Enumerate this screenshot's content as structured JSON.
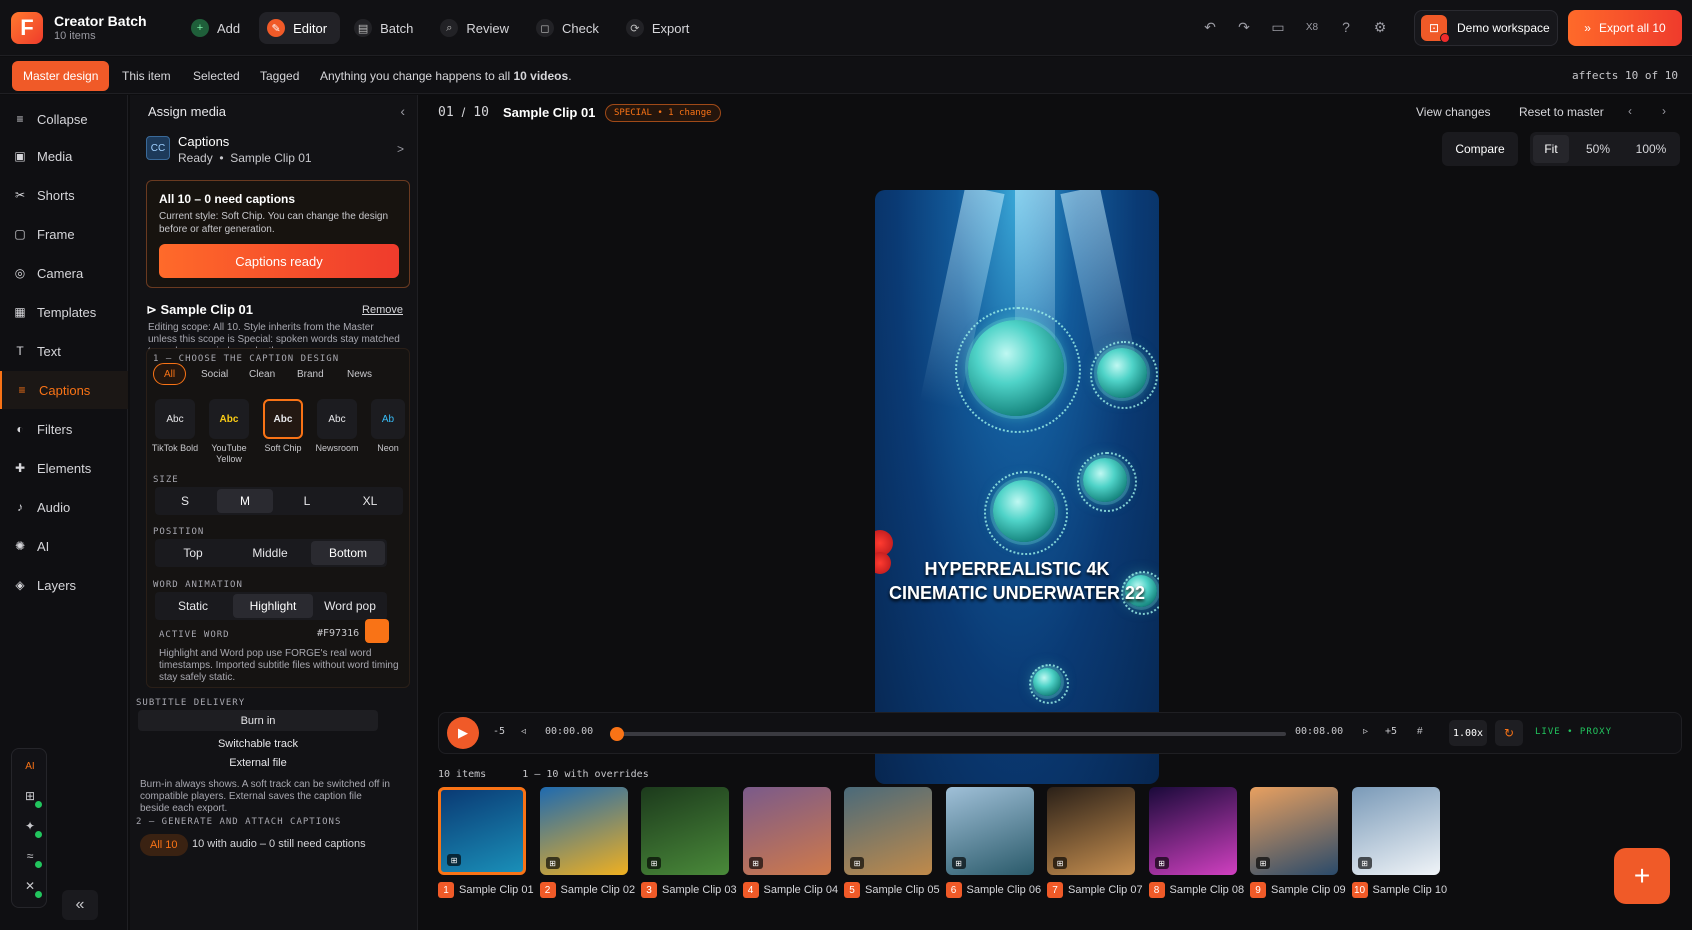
{
  "app": {
    "title": "Creator Batch",
    "subtitle": "10 items",
    "logo": "F"
  },
  "nav_tabs": [
    {
      "label": "Add",
      "icon": "+"
    },
    {
      "label": "Editor",
      "icon": "✎"
    },
    {
      "label": "Batch",
      "icon": "▤"
    },
    {
      "label": "Review",
      "icon": "⌕"
    },
    {
      "label": "Check",
      "icon": "◻"
    },
    {
      "label": "Export",
      "icon": "⟳"
    }
  ],
  "top_icons": {
    "undo": "↶",
    "redo": "↷",
    "monitor": "▭",
    "x8": "X8",
    "help": "?",
    "settings": "⚙"
  },
  "workspace": {
    "label": "Demo workspace",
    "icon": "⊡"
  },
  "export_all": {
    "label": "Export all 10",
    "icon": "»"
  },
  "scopes": [
    "Master design",
    "This item",
    "Selected",
    "Tagged"
  ],
  "scope_message_prefix": "Anything you change happens to all ",
  "scope_message_count": "10 videos",
  "scope_message_suffix": ".",
  "affects": "affects 10 of 10",
  "left_nav": [
    {
      "label": "Collapse",
      "icon": "≡"
    },
    {
      "label": "Media",
      "icon": "▣"
    },
    {
      "label": "Shorts",
      "icon": "✂"
    },
    {
      "label": "Frame",
      "icon": "▢"
    },
    {
      "label": "Camera",
      "icon": "◎"
    },
    {
      "label": "Templates",
      "icon": "▦"
    },
    {
      "label": "Text",
      "icon": "T"
    },
    {
      "label": "Captions",
      "icon": "≡"
    },
    {
      "label": "Filters",
      "icon": "◐"
    },
    {
      "label": "Elements",
      "icon": "✚"
    },
    {
      "label": "Audio",
      "icon": "♪"
    },
    {
      "label": "AI",
      "icon": "✺"
    },
    {
      "label": "Layers",
      "icon": "◈"
    }
  ],
  "ai_dock": {
    "label": "AI",
    "icons": [
      "⊞",
      "✦",
      "≈",
      "✕"
    ],
    "collapse": "«"
  },
  "panel": {
    "header": "Assign media",
    "close": "‹",
    "captions_card": {
      "title": "Captions",
      "status": "Ready",
      "separator": "•",
      "clip": "Sample Clip 01",
      "icon": "CC",
      "chevron": ">"
    },
    "need_box": {
      "title": "All 10 – 0 need captions",
      "desc": "Current style: Soft Chip. You can change the design before or after generation.",
      "button": "Captions ready"
    },
    "clip_name": "Sample Clip 01",
    "clip_remove": "Remove",
    "scope_desc": "Editing scope: All 10. Style inherits from the Master unless this scope is Special: spoken words stay matched to each source independently.",
    "design_section": "1 – CHOOSE THE CAPTION DESIGN",
    "chips": [
      "All",
      "Social",
      "Clean",
      "Brand",
      "News"
    ],
    "styles": [
      {
        "sample": "Abc",
        "name": "TikTok Bold",
        "color": "#e7e7ea"
      },
      {
        "sample": "Abc",
        "name": "YouTube Yellow",
        "color": "#facc15"
      },
      {
        "sample": "Abc",
        "name": "Soft Chip",
        "color": "#ffffff"
      },
      {
        "sample": "Abc",
        "name": "Newsroom",
        "color": "#e7e7ea"
      },
      {
        "sample": "Ab",
        "name": "Neon",
        "color": "#38bdf8"
      }
    ],
    "size_label": "SIZE",
    "sizes": [
      "S",
      "M",
      "L",
      "XL"
    ],
    "position_label": "POSITION",
    "positions": [
      "Top",
      "Middle",
      "Bottom"
    ],
    "animation_label": "WORD ANIMATION",
    "animations": [
      "Static",
      "Highlight",
      "Word pop"
    ],
    "active_word_label": "ACTIVE WORD",
    "active_word_hex": "#F97316",
    "word_note": "Highlight and Word pop use FORGE's real word timestamps. Imported subtitle files without word timing stay safely static.",
    "delivery_label": "SUBTITLE DELIVERY",
    "deliveries": [
      "Burn in",
      "Switchable track",
      "External file"
    ],
    "delivery_note": "Burn-in always shows. A soft track can be switched off in compatible players. External saves the caption file beside each export.",
    "generate_label": "2 – GENERATE AND ATTACH CAPTIONS",
    "generate_chip": "All 10",
    "generate_msg": "10 with audio – 0 still need captions"
  },
  "main": {
    "index": "01",
    "slash": "/",
    "total": "10",
    "clip_title": "Sample Clip 01",
    "special_badge": "SPECIAL • 1 change",
    "view_changes": "View changes",
    "reset_master": "Reset to master",
    "compare": "Compare",
    "zoom": [
      "Fit",
      "50%",
      "100%"
    ],
    "caption_text_line1": "HYPERREALISTIC 4K",
    "caption_text_line2": "CINEMATIC UNDERWATER 22"
  },
  "transport": {
    "play": "▶",
    "back5": "-5",
    "prev_frame": "◃",
    "time_start": "00:00.00",
    "time_end": "00:08.00",
    "next_frame": "▹",
    "fwd5": "+5",
    "hash": "#",
    "speed": "1.00x",
    "loop": "↻",
    "live": "LIVE • PROXY"
  },
  "strip": {
    "count": "10 items",
    "overrides": "1 – 10 with overrides",
    "items": [
      {
        "num": "1",
        "label": "Sample Clip 01",
        "colors": [
          "#0a3a74",
          "#1a8fb8"
        ]
      },
      {
        "num": "2",
        "label": "Sample Clip 02",
        "colors": [
          "#1e6ab0",
          "#f0b020"
        ]
      },
      {
        "num": "3",
        "label": "Sample Clip 03",
        "colors": [
          "#1c3a1c",
          "#4a8a3a"
        ]
      },
      {
        "num": "4",
        "label": "Sample Clip 04",
        "colors": [
          "#7a5a8a",
          "#d07a4a"
        ]
      },
      {
        "num": "5",
        "label": "Sample Clip 05",
        "colors": [
          "#4a6a7a",
          "#c08a4a"
        ]
      },
      {
        "num": "6",
        "label": "Sample Clip 06",
        "colors": [
          "#a0c0d8",
          "#2a5a6a"
        ]
      },
      {
        "num": "7",
        "label": "Sample Clip 07",
        "colors": [
          "#2a2018",
          "#c89050"
        ]
      },
      {
        "num": "8",
        "label": "Sample Clip 08",
        "colors": [
          "#1a0a3a",
          "#d040c0"
        ]
      },
      {
        "num": "9",
        "label": "Sample Clip 09",
        "colors": [
          "#e8a060",
          "#2a4a6a"
        ]
      },
      {
        "num": "10",
        "label": "Sample Clip 10",
        "colors": [
          "#7a9ab8",
          "#f0f4f8"
        ]
      }
    ],
    "add": "+"
  }
}
